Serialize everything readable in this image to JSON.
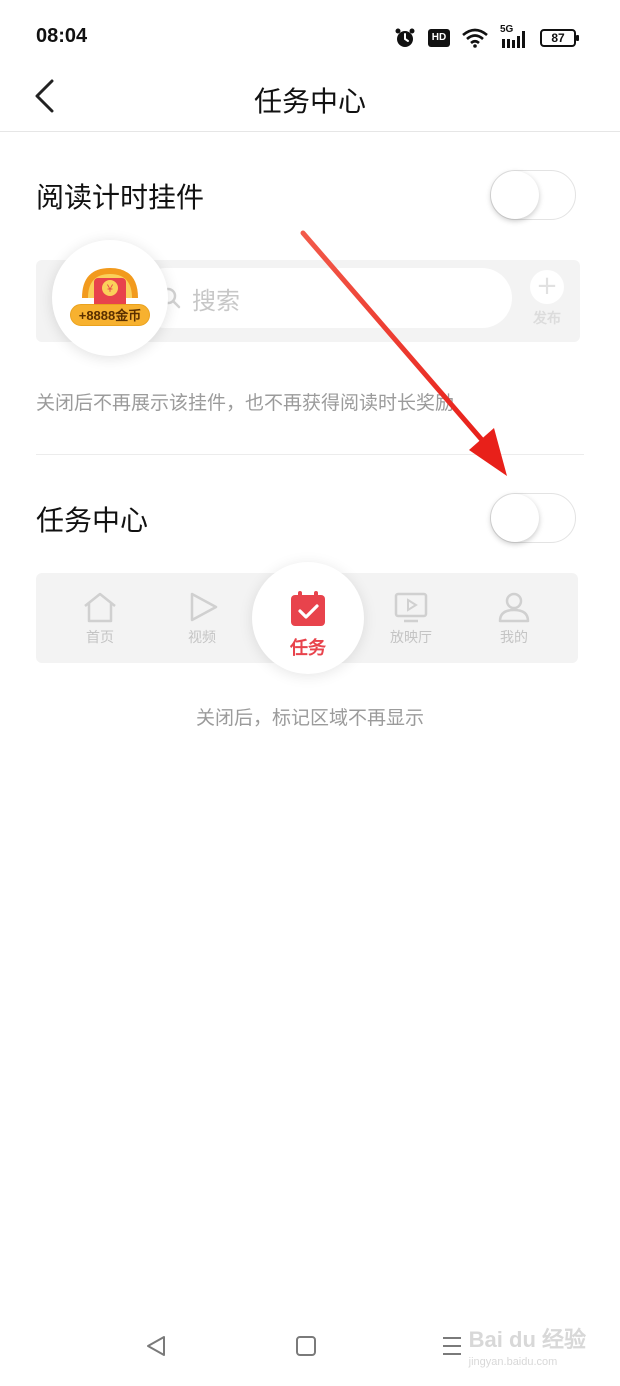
{
  "status_bar": {
    "time": "08:04",
    "network": "5G",
    "hd": "HD",
    "battery": "87",
    "icons": [
      "alarm-icon",
      "hd-icon",
      "wifi-icon",
      "cellular-icon",
      "battery-icon"
    ]
  },
  "header": {
    "title": "任务中心",
    "back_icon": "chevron-left-icon"
  },
  "settings": {
    "reading_widget": {
      "label": "阅读计时挂件",
      "enabled": false,
      "hint": "关闭后不再展示该挂件，也不再获得阅读时长奖励"
    },
    "task_center": {
      "label": "任务中心",
      "enabled": false,
      "hint": "关闭后，标记区域不再显示"
    }
  },
  "widget_preview": {
    "coin_badge": "+8888金币",
    "search_placeholder": "搜索",
    "publish_label": "发布"
  },
  "tabbar_preview": {
    "tabs": [
      {
        "label": "首页",
        "icon": "home-icon"
      },
      {
        "label": "视频",
        "icon": "play-icon"
      },
      {
        "label": "任务",
        "icon": "calendar-check-icon"
      },
      {
        "label": "放映厅",
        "icon": "tv-icon"
      },
      {
        "label": "我的",
        "icon": "user-icon"
      }
    ]
  },
  "watermark": {
    "main": "Bai du 经验",
    "sub": "jingyan.baidu.com"
  },
  "colors": {
    "accent": "#e8434c",
    "coin": "#f7b12f",
    "arrow": "#e8201a"
  }
}
